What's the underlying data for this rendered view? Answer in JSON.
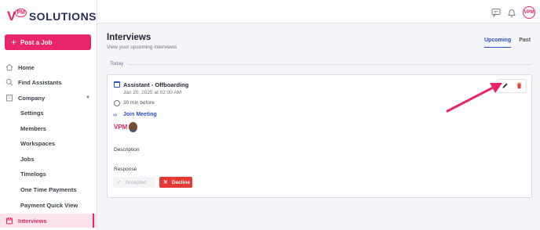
{
  "brand": {
    "mark": "V",
    "pm": "PM",
    "name": "SOLUTIONS"
  },
  "sidebar": {
    "post_job_label": "Post a Job",
    "items": [
      {
        "label": "Home",
        "icon": "home-icon"
      },
      {
        "label": "Find Assistants",
        "icon": "search-icon"
      },
      {
        "label": "Company",
        "icon": "building-icon"
      },
      {
        "label": "Settings"
      },
      {
        "label": "Members"
      },
      {
        "label": "Workspaces"
      },
      {
        "label": "Jobs"
      },
      {
        "label": "Timelogs"
      },
      {
        "label": "One Time Payments"
      },
      {
        "label": "Payment Quick View"
      },
      {
        "label": "Interviews",
        "icon": "calendar-icon",
        "active": true
      }
    ]
  },
  "topbar": {
    "avatar_label": "VPM"
  },
  "header": {
    "title": "Interviews",
    "subtitle": "View your upcoming interviews",
    "tabs": [
      "Upcoming",
      "Past"
    ]
  },
  "group_label": "Today",
  "interview": {
    "title": "Assistant - Offboarding",
    "datetime": "Jan 20, 2025 at 02:00 AM",
    "reminder": "30 min before",
    "join_label": "Join Meeting",
    "participant_logo": "VPM",
    "description_label": "Description",
    "response_label": "Response",
    "accepted_label": "Accepted",
    "decline_label": "Decline"
  },
  "colors": {
    "brand": "#e8246b",
    "link": "#2b4fbf",
    "decline": "#e53935"
  }
}
